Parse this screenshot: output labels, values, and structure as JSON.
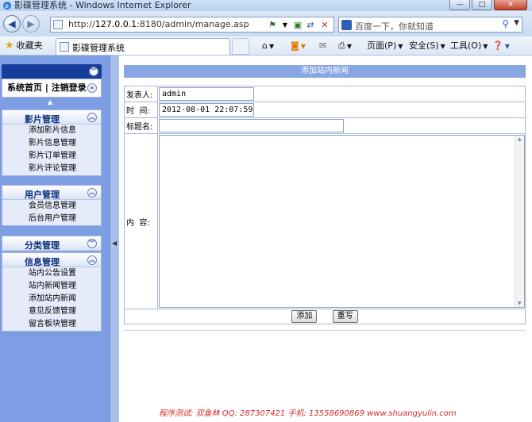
{
  "window": {
    "title": "影碟管理系统 - Windows Internet Explorer",
    "minimize": "—",
    "maximize": "□",
    "close": "✕"
  },
  "addressbar": {
    "url_prefix": "http://",
    "url_host": "127.0.0.1",
    "url_rest": ":8180/admin/manage.asp",
    "search_placeholder": "百度一下，你就知道"
  },
  "commandbar": {
    "favorites_label": "收藏夹",
    "tab_title": "影碟管理系统",
    "page_menu": "页面(P)",
    "safety_menu": "安全(S)",
    "tools_menu": "工具(O)"
  },
  "sidebar": {
    "links": "系统首页 | 注销登录",
    "groups": [
      {
        "title": "影片管理",
        "items": [
          "添加影片信息",
          "影片信息管理",
          "影片订单管理",
          "影片评论管理"
        ]
      },
      {
        "title": "用户管理",
        "items": [
          "会员信息管理",
          "后台用户管理"
        ]
      },
      {
        "title": "分类管理",
        "items": []
      },
      {
        "title": "信息管理",
        "items": [
          "站内公告设置",
          "站内新闻管理",
          "添加站内新闻",
          "意见反馈管理",
          "留言板块管理"
        ]
      }
    ]
  },
  "form": {
    "title": "添加站内新闻",
    "publisher_label": "发表人:",
    "publisher_value": "admin",
    "time_label": "时  间:",
    "time_value": "2012-08-01 22:07:59",
    "subject_label": "标题名:",
    "subject_value": "",
    "content_label": "内  容:",
    "content_value": "",
    "add_button": "添加",
    "reset_button": "重写"
  },
  "footer": "程序测试: 双鱼林  QQ: 287307421  手机: 13558690869  www.shuangyulin.com",
  "icons": {
    "back": "back-arrow-icon",
    "forward": "forward-arrow-icon",
    "refresh": "refresh-icon",
    "stop": "stop-icon",
    "home": "home-icon",
    "rss": "rss-icon",
    "mail": "mail-icon",
    "print": "print-icon",
    "collapse": "chevron-double-icon"
  },
  "colors": {
    "sidebar_bg": "#7e9ee3",
    "header_bar": "#163c9c",
    "form_title_bg": "#88a6e2",
    "footer_text": "#d42a2a"
  }
}
